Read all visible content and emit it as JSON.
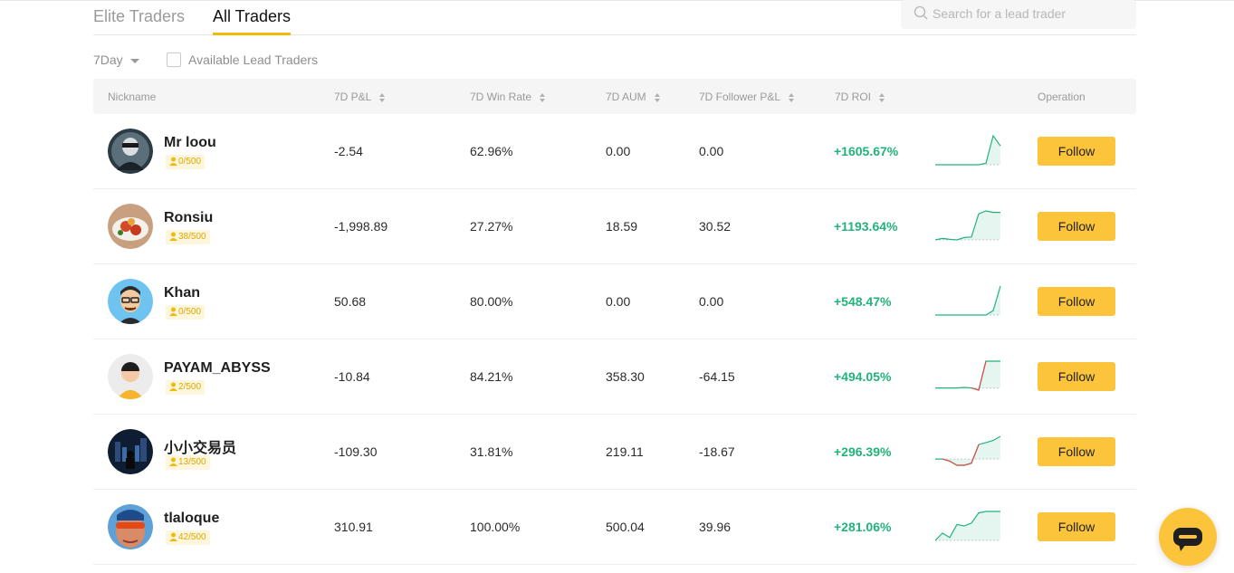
{
  "tabs": [
    {
      "label": "Elite Traders",
      "active": false
    },
    {
      "label": "All Traders",
      "active": true
    }
  ],
  "search": {
    "placeholder": "Search for a lead trader",
    "icon": "search-icon"
  },
  "filters": {
    "period": "7Day",
    "available_label": "Available Lead Traders",
    "available_checked": false
  },
  "columns": {
    "nickname": "Nickname",
    "pnl": "7D P&L",
    "win_rate": "7D Win Rate",
    "aum": "7D AUM",
    "follower_pnl": "7D Follower P&L",
    "roi": "7D ROI",
    "operation": "Operation"
  },
  "colors": {
    "accent": "#fcc43a",
    "positive": "#22b37a",
    "negative": "#e04a4a",
    "tab_underline": "#f0b90b"
  },
  "traders": [
    {
      "nickname": "Mr loou",
      "followers": "0/500",
      "pnl": "-2.54",
      "win_rate": "62.96%",
      "aum": "0.00",
      "follower_pnl": "0.00",
      "roi": "+1605.67%",
      "follow_label": "Follow",
      "roi_series": [
        0,
        0,
        0,
        0,
        0,
        0,
        0,
        0.05,
        1.0,
        0.65
      ],
      "baseline_index": 0
    },
    {
      "nickname": "Ronsiu",
      "followers": "38/500",
      "pnl": "-1,998.89",
      "win_rate": "27.27%",
      "aum": "18.59",
      "follower_pnl": "30.52",
      "roi": "+1193.64%",
      "follow_label": "Follow",
      "roi_series": [
        0,
        0.05,
        0.02,
        0,
        0.08,
        0.1,
        0.9,
        1.0,
        0.95,
        0.95
      ],
      "baseline_index": 0
    },
    {
      "nickname": "Khan",
      "followers": "0/500",
      "pnl": "50.68",
      "win_rate": "80.00%",
      "aum": "0.00",
      "follower_pnl": "0.00",
      "roi": "+548.47%",
      "follow_label": "Follow",
      "roi_series": [
        0,
        0,
        0,
        0,
        0,
        0,
        0,
        0,
        0.15,
        1.0
      ],
      "baseline_index": 0
    },
    {
      "nickname": "PAYAM_ABYSS",
      "followers": "2/500",
      "pnl": "-10.84",
      "win_rate": "84.21%",
      "aum": "358.30",
      "follower_pnl": "-64.15",
      "roi": "+494.05%",
      "follow_label": "Follow",
      "roi_series": [
        0,
        0,
        0,
        0,
        0.02,
        0,
        -0.08,
        1.0,
        1.0,
        1.0
      ],
      "baseline_index": 0
    },
    {
      "nickname": "小小交易员",
      "followers": "13/500",
      "pnl": "-109.30",
      "win_rate": "31.81%",
      "aum": "219.11",
      "follower_pnl": "-18.67",
      "roi": "+296.39%",
      "follow_label": "Follow",
      "roi_series": [
        0.45,
        0.45,
        0.4,
        0.3,
        0.3,
        0.35,
        0.8,
        0.85,
        0.9,
        1.0
      ],
      "baseline_index": 0
    },
    {
      "nickname": "tlaloque",
      "followers": "42/500",
      "pnl": "310.91",
      "win_rate": "100.00%",
      "aum": "500.04",
      "follower_pnl": "39.96",
      "roi": "+281.06%",
      "follow_label": "Follow",
      "roi_series": [
        0,
        0.25,
        0.1,
        0.55,
        0.5,
        0.6,
        0.95,
        1.0,
        1.0,
        1.0
      ],
      "baseline_index": 0
    }
  ],
  "avatars": [
    "masked-trader-avatar",
    "food-plate-avatar",
    "cartoon-man-glasses-avatar",
    "default-person-avatar",
    "city-night-avatar",
    "sunglasses-man-avatar"
  ],
  "chat_icon": "chat-bubble-icon"
}
